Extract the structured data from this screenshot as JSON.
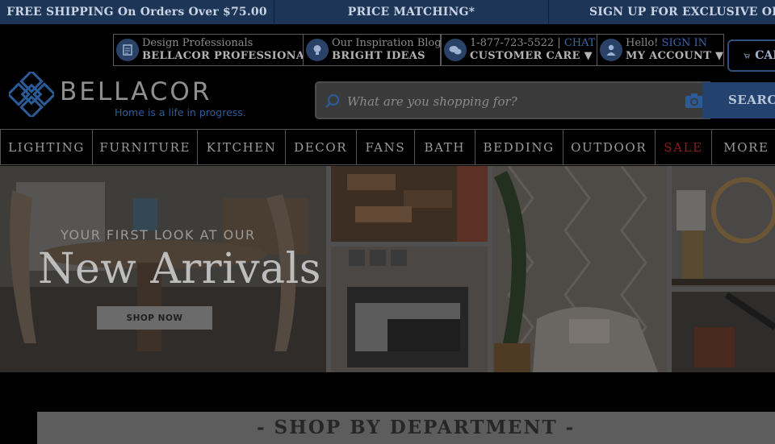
{
  "promo_bar": [
    "FREE SHIPPING On Orders Over $75.00",
    "PRICE MATCHING*",
    "SIGN UP FOR EXCLUSIVE OFFERS"
  ],
  "utility": {
    "pro": {
      "top": "Design Professionals",
      "bottom": "BELLACOR PROFESSIONAL",
      "icon": "clipboard-icon"
    },
    "blog": {
      "top": "Our Inspiration Blog",
      "bottom": "BRIGHT IDEAS",
      "icon": "lightbulb-icon"
    },
    "care": {
      "phone": "1-877-723-5522 |",
      "chat": "CHAT",
      "bottom": "CUSTOMER CARE ▼",
      "icon": "chat-bubbles-icon"
    },
    "account": {
      "hello": "Hello!",
      "sign_in": "SIGN IN",
      "bottom": "MY ACCOUNT ▼",
      "icon": "user-icon"
    },
    "cart_label": "CART"
  },
  "logo": {
    "name": "BELLACOR",
    "tagline": "Home is a life in progress."
  },
  "search": {
    "placeholder": "What are you shopping for?",
    "button": "SEARCH"
  },
  "nav": [
    "LIGHTING",
    "FURNITURE",
    "KITCHEN",
    "DECOR",
    "FANS",
    "BATH",
    "BEDDING",
    "OUTDOOR",
    "SALE",
    "MORE"
  ],
  "hero": {
    "eyebrow": "YOUR FIRST LOOK AT OUR",
    "title": "New Arrivals",
    "button": "SHOP NOW"
  },
  "department_heading": "- SHOP BY DEPARTMENT -",
  "colors": {
    "promo_bg": "#1d3556",
    "accent": "#23426e",
    "sale": "#8c1c1c"
  }
}
